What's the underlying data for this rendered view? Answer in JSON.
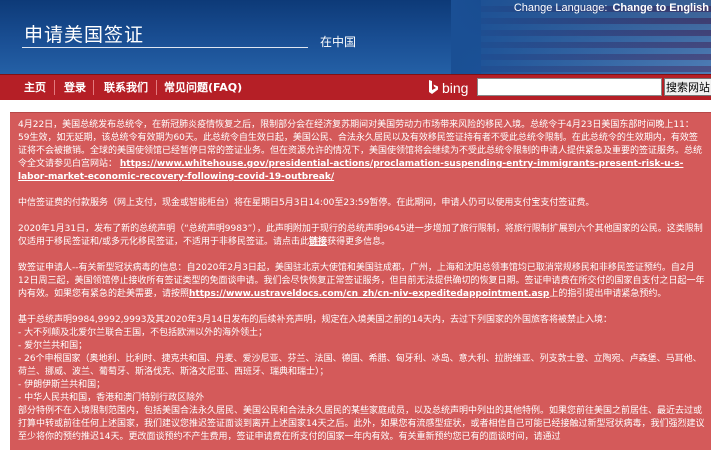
{
  "header": {
    "lang_label": "Change Language:",
    "lang_link": "Change to English",
    "title": "申请美国签证",
    "subtitle": "在中国"
  },
  "nav": {
    "items": [
      "主页",
      "登录",
      "联系我们",
      "常见问题(FAQ)"
    ],
    "bing_label": "bing",
    "search_value": "",
    "search_button": "搜索网站"
  },
  "content": {
    "para1_a": "4月22日，美国总统发布总统令，在新冠肺炎疫情恢复之后，限制部分会在经济复苏期间对美国劳动力市场带来风险的移民入境。总统令于4月23日美国东部时间晚上11：59生效，如无延期，该总统令有效期为60天。此总统令自生效日起，美国公民、合法永久居民以及有效移民签证持有者不受此总统令限制。在此总统令的生效期内，有效签证将不会被撤销。全球的美国使领馆已经暂停日常的签证业务。但在资源允许的情况下，美国使领馆将会继续为不受此总统令限制的申请人提供紧急及重要的签证服务。总统令全文请参见白宫网站：",
    "para1_link": "https://www.whitehouse.gov/presidential-actions/proclamation-suspending-entry-immigrants-present-risk-u-s-labor-market-economic-recovery-following-covid-19-outbreak/",
    "para2": "中信签证费的付款服务（网上支付，现金或智能柜台）将在星期日5月3日14:00至23:59暂停。在此期间，申请人仍可以使用支付宝支付签证费。",
    "para3_a": "2020年1月31日，发布了新的总统声明（“总统声明9983”），此声明附加于现行的总统声明9645进一步增加了旅行限制，将旅行限制扩展到六个其他国家的公民。这类限制仅适用于移民签证和/或多元化移民签证，不适用于非移民签证。请点击此",
    "para3_link": "链接",
    "para3_b": "获得更多信息。",
    "para4_a": "致签证申请人--有关新型冠状病毒的信息：自2020年2月3日起，美国驻北京大使馆和美国驻成都，广州，上海和沈阳总领事馆均已取消常规移民和非移民签证预约。自2月12日周三起，美国领馆停止接收所有签证类型的免面谈申请。我们会尽快恢复正常签证服务，但目前无法提供确切的恢复日期。签证申请费在所交付的国家自支付之日起一年内有效。如果您有紧急的赴美需要，请按照",
    "para4_link": "https://www.ustraveldocs.com/cn_zh/cn-niv-expeditedappointment.asp",
    "para4_b": "上的指引提出申请紧急预约。",
    "para5_intro": "基于总统声明9984,9992,9993及其2020年3月14日发布的后续补充声明，规定在入境美国之前的14天内，去过下列国家的外国旅客将被禁止入境：",
    "list": [
      "- 大不列颠及北爱尔兰联合王国，不包括欧洲以外的海外领土；",
      "- 爱尔兰共和国；",
      "- 26个申根国家（奥地利、比利时、捷克共和国、丹麦、爱沙尼亚、芬兰、法国、德国、希腊、匈牙利、冰岛、意大利、拉脱维亚、列支敦士登、立陶宛、卢森堡、马耳他、荷兰、挪威、波兰、葡萄牙、斯洛伐克、斯洛文尼亚、西班牙、瑞典和瑞士）；",
      "- 伊朗伊斯兰共和国；",
      "- 中华人民共和国，香港和澳门特别行政区除外"
    ],
    "para6": "部分特例不在入境限制范围内，包括美国合法永久居民、美国公民和合法永久居民的某些家庭成员，以及总统声明中列出的其他特例。如果您前往美国之前居住、最近去过或打算中转或前往任何上述国家，我们建议您推迟签证面谈到离开上述国家14天之后。此外，如果您有流感型症状，或者相信自己可能已经接触过新型冠状病毒，我们强烈建议至少将你的预约推迟14天。更改面谈预约不产生费用，签证申请费在所支付的国家一年内有效。有关重新预约您已有的面谈时间，请通过"
  }
}
